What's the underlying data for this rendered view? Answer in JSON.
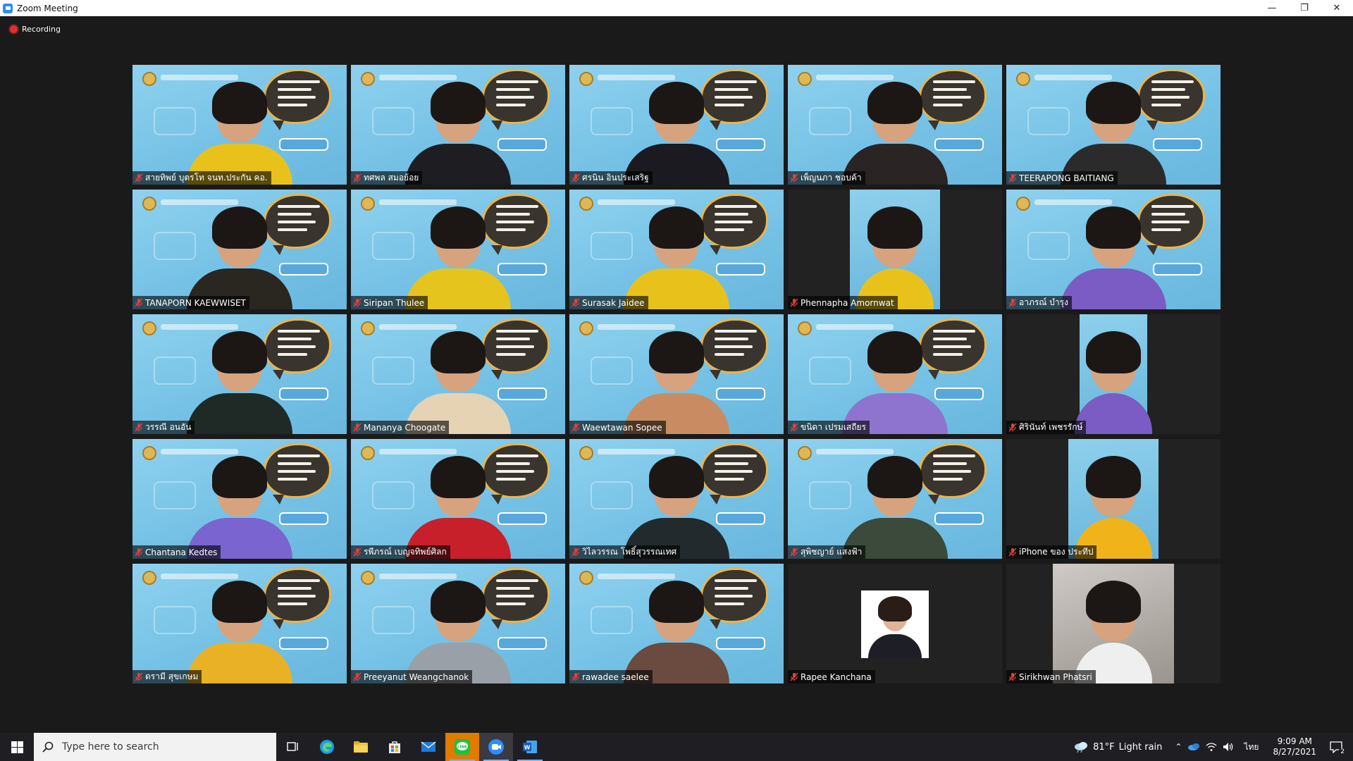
{
  "window": {
    "title": "Zoom Meeting"
  },
  "recording": {
    "label": "Recording"
  },
  "participants": [
    {
      "name": "สายทิพย์ บุตรโท จนท.ประกัน คอ."
    },
    {
      "name": "ทศพล สมอย้อย"
    },
    {
      "name": "ศรนิน อินประเสริฐ"
    },
    {
      "name": "เพ็ญนภา ชอบค้า"
    },
    {
      "name": "TEERAPONG BAITIANG"
    },
    {
      "name": "TANAPORN KAEWWISET"
    },
    {
      "name": "Siripan Thulee"
    },
    {
      "name": "Surasak Jaidee"
    },
    {
      "name": "Phennapha Amornwat"
    },
    {
      "name": "อาภรณ์ บำรุง"
    },
    {
      "name": "วรรณี อนอัน"
    },
    {
      "name": "Mananya Choogate"
    },
    {
      "name": "Waewtawan Sopee"
    },
    {
      "name": "ขนิดา เปรมเสถียร"
    },
    {
      "name": "ศิรินันท์ เพชรรักษ์"
    },
    {
      "name": "Chantana Kedtes"
    },
    {
      "name": "รพีภรณ์ เบญจทิพย์ศิลก"
    },
    {
      "name": "วิไลวรรณ โพธิ์สุวรรณเทศ"
    },
    {
      "name": "สุพิชญาย์ แสงฟ้า"
    },
    {
      "name": "iPhone ของ ประทีป"
    },
    {
      "name": "ดรามี สุขเกษม"
    },
    {
      "name": "Preeyanut Weangchanok"
    },
    {
      "name": "rawadee saelee"
    },
    {
      "name": "Rapee Kanchana"
    },
    {
      "name": "Sirikhwan Phatsri"
    }
  ],
  "taskbar": {
    "search_placeholder": "Type here to search",
    "weather": {
      "temp": "81°F",
      "condition": "Light rain"
    },
    "language": "ไทย",
    "time": "9:09 AM",
    "date": "8/27/2021",
    "notification_count": "2"
  },
  "colors": {
    "accent": "#2d8cff",
    "recording": "#e0302e",
    "mute": "#e04040"
  }
}
